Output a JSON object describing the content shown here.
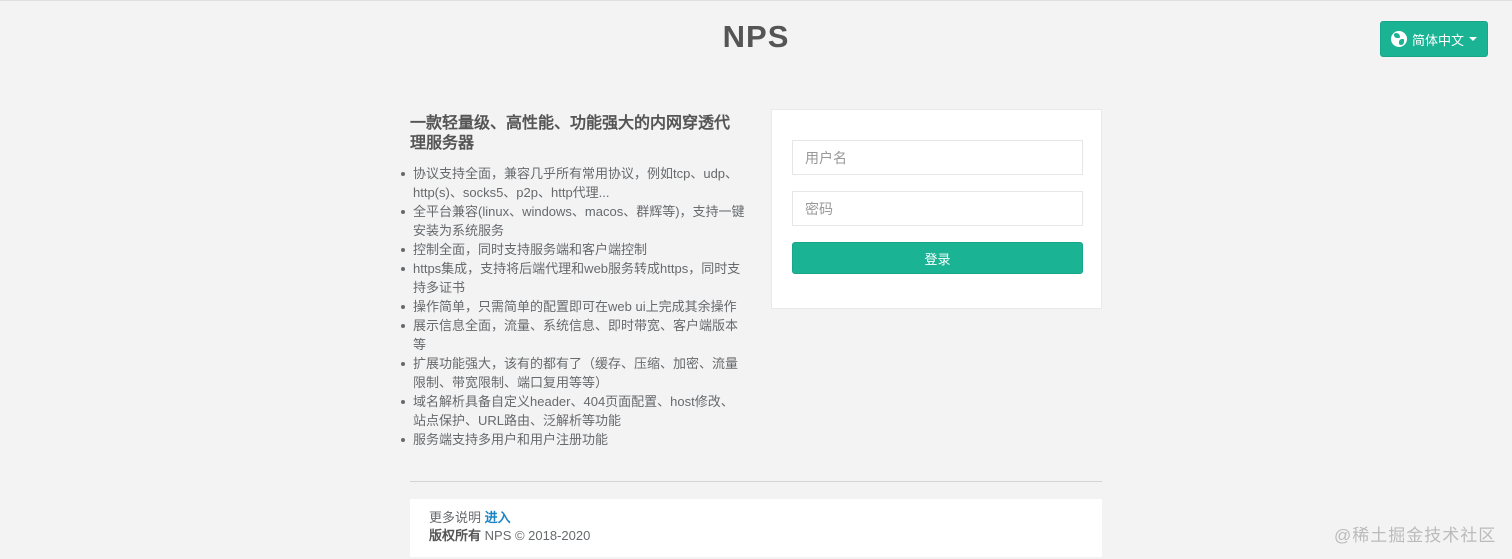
{
  "header": {
    "logo": "NPS",
    "language_button": "简体中文",
    "language_icon": "globe-icon"
  },
  "intro": {
    "title": "一款轻量级、高性能、功能强大的内网穿透代理服务器",
    "features": [
      "协议支持全面，兼容几乎所有常用协议，例如tcp、udp、http(s)、socks5、p2p、http代理...",
      "全平台兼容(linux、windows、macos、群辉等)，支持一键安装为系统服务",
      "控制全面，同时支持服务端和客户端控制",
      "https集成，支持将后端代理和web服务转成https，同时支持多证书",
      "操作简单，只需简单的配置即可在web ui上完成其余操作",
      "展示信息全面，流量、系统信息、即时带宽、客户端版本等",
      "扩展功能强大，该有的都有了（缓存、压缩、加密、流量限制、带宽限制、端口复用等等）",
      "域名解析具备自定义header、404页面配置、host修改、站点保护、URL路由、泛解析等功能",
      "服务端支持多用户和用户注册功能"
    ]
  },
  "login": {
    "username_placeholder": "用户名",
    "password_placeholder": "密码",
    "submit_label": "登录"
  },
  "footer": {
    "more_label": "更多说明",
    "more_link": "进入",
    "copyright_label": "版权所有",
    "copyright_text": "NPS © 2018-2020"
  },
  "watermark": "@稀土掘金技术社区",
  "colors": {
    "accent": "#1ab394",
    "link": "#1c84c6",
    "background": "#f3f3f4"
  }
}
